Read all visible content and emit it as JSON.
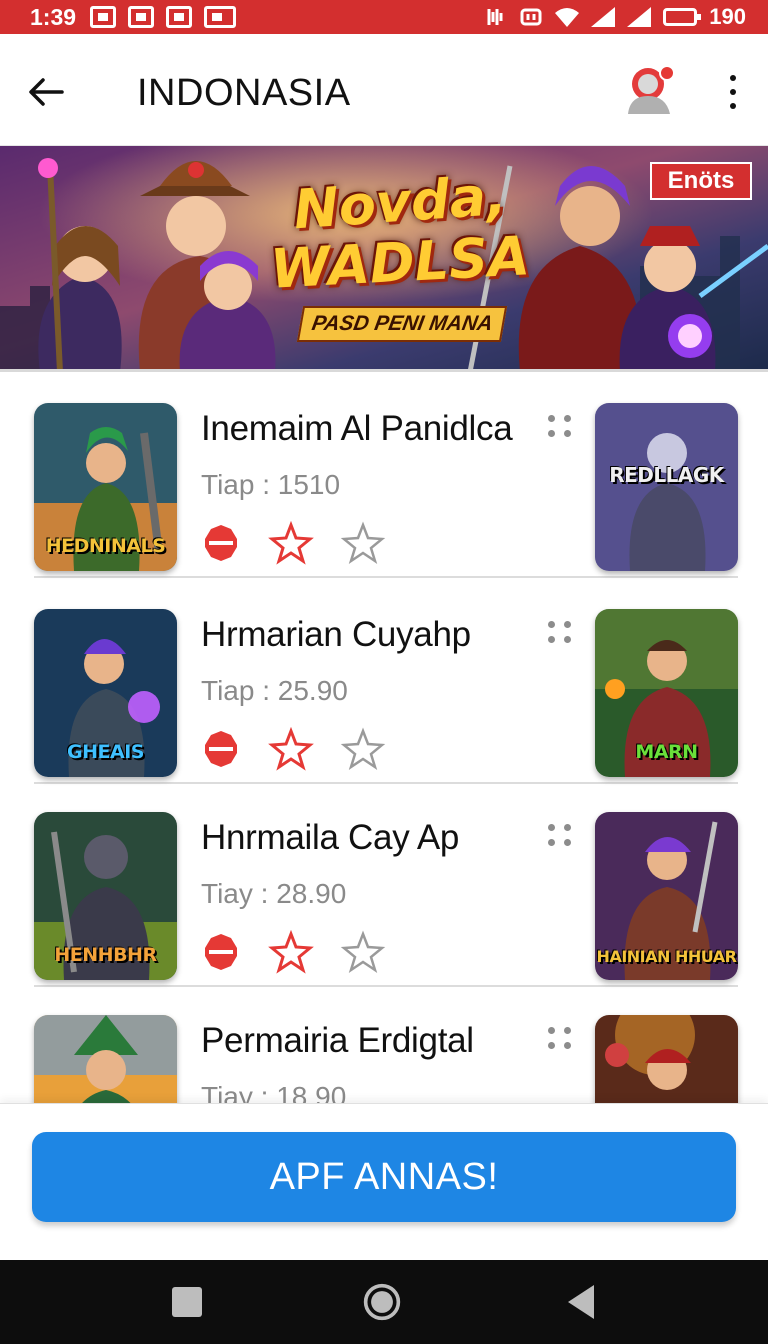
{
  "status_bar": {
    "time": "1:39",
    "battery": "190"
  },
  "app_bar": {
    "title": "INDONASIA"
  },
  "banner": {
    "title_line1": "Novda,",
    "title_line2": "WADLSA",
    "subtitle": "PASD PENI MANA",
    "badge": "Enöts"
  },
  "items": [
    {
      "title": "Inemaim Al Panidlca",
      "meta": "Tiap : 1510",
      "thumb_left_label": "HEDNINALS",
      "thumb_right_label": "REDLLAGK"
    },
    {
      "title": "Hrmarian Cuyahp",
      "meta": "Tiap : 25.90",
      "thumb_left_label": "GHEAIS",
      "thumb_right_label": "MARN"
    },
    {
      "title": "Hnrmaila Cay Ap",
      "meta": "Tiay : 28.90",
      "thumb_left_label": "HENHBHR",
      "thumb_right_label": "HAINIAN HHUAR"
    },
    {
      "title": "Permairia Erdigtal",
      "meta": "Tiay : 18.90",
      "thumb_left_label": "",
      "thumb_right_label": ""
    }
  ],
  "cta": {
    "label": "APF ANNAS!"
  },
  "colors": {
    "accent": "#d32f2f",
    "button": "#1e86e4"
  }
}
